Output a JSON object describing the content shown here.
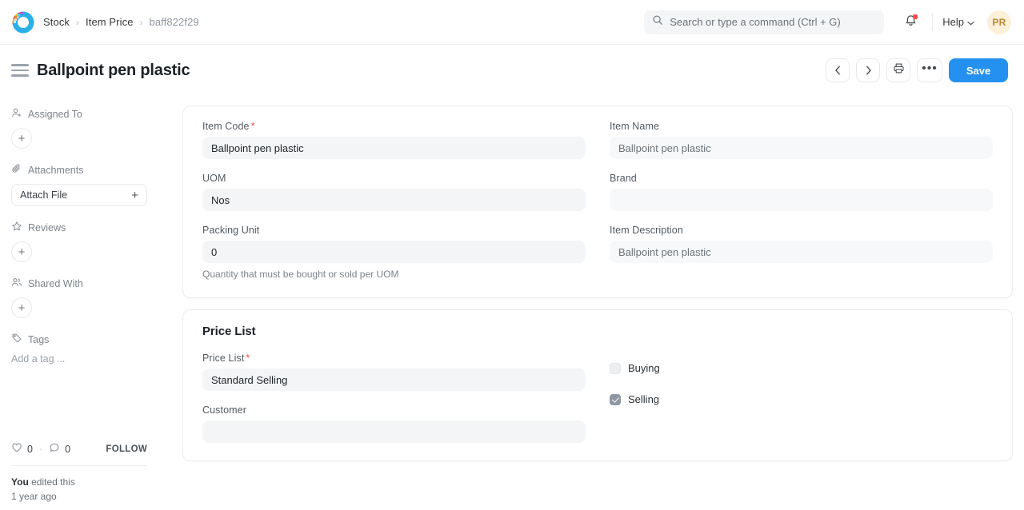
{
  "navbar": {
    "logo_name": "frappe-logo",
    "breadcrumbs": [
      {
        "label": "Stock",
        "muted": false
      },
      {
        "label": "Item Price",
        "muted": false
      },
      {
        "label": "baff822f29",
        "muted": true
      }
    ],
    "separator": "›",
    "search": {
      "placeholder": "Search or type a command (Ctrl + G)",
      "value": ""
    },
    "notifications": {
      "icon": "bell-icon",
      "has_badge": true
    },
    "help": {
      "label": "Help",
      "caret": "⌄"
    },
    "avatar": {
      "initials": "PR",
      "bg": "#fdf0d9",
      "fg": "#b98a2e"
    }
  },
  "page_head": {
    "menu_icon": "hamburger-icon",
    "title": "Ballpoint pen plastic",
    "actions": {
      "prev": "‹",
      "next": "›",
      "print_icon": "printer-icon",
      "more": "•••",
      "save_label": "Save",
      "save_color": "#2490ef"
    }
  },
  "sidebar": {
    "sections": [
      {
        "label": "Assigned To",
        "icon": "user-plus-icon",
        "control": "plus-circle"
      },
      {
        "label": "Attachments",
        "icon": "paperclip-icon",
        "control": "attach-button",
        "button_label": "Attach File",
        "button_plus": "+"
      },
      {
        "label": "Reviews",
        "icon": "star-icon",
        "control": "plus-circle"
      },
      {
        "label": "Shared With",
        "icon": "users-icon",
        "control": "plus-circle"
      },
      {
        "label": "Tags",
        "icon": "tag-icon",
        "control": "tag-input",
        "placeholder": "Add a tag ..."
      }
    ],
    "plus_glyph": "+",
    "footer": {
      "like_icon": "heart-icon",
      "like_count": "0",
      "separator": "·",
      "comment_icon": "comment-icon",
      "comment_count": "0",
      "follow_label": "FOLLOW",
      "edited_by": "You",
      "edited_text": " edited this",
      "edited_time": "1 year ago"
    }
  },
  "main": {
    "details_card": {
      "left_fields": [
        {
          "label": "Item Code",
          "required": true,
          "value": "Ballpoint pen plastic",
          "readonly": false,
          "help": ""
        },
        {
          "label": "UOM",
          "required": false,
          "value": "Nos",
          "readonly": false,
          "help": ""
        },
        {
          "label": "Packing Unit",
          "required": false,
          "value": "0",
          "readonly": false,
          "help": "Quantity that must be bought or sold per UOM"
        }
      ],
      "right_fields": [
        {
          "label": "Item Name",
          "required": false,
          "value": "Ballpoint pen plastic",
          "readonly": true,
          "help": ""
        },
        {
          "label": "Brand",
          "required": false,
          "value": "",
          "readonly": true,
          "help": ""
        },
        {
          "label": "Item Description",
          "required": false,
          "value": "Ballpoint pen plastic",
          "readonly": true,
          "help": ""
        }
      ]
    },
    "price_list_card": {
      "title": "Price List",
      "left_fields": [
        {
          "label": "Price List",
          "required": true,
          "value": "Standard Selling",
          "readonly": false,
          "help": ""
        },
        {
          "label": "Customer",
          "required": false,
          "value": "",
          "readonly": false,
          "help": ""
        }
      ],
      "checkboxes": [
        {
          "label": "Buying",
          "checked": false
        },
        {
          "label": "Selling",
          "checked": true
        }
      ]
    }
  }
}
